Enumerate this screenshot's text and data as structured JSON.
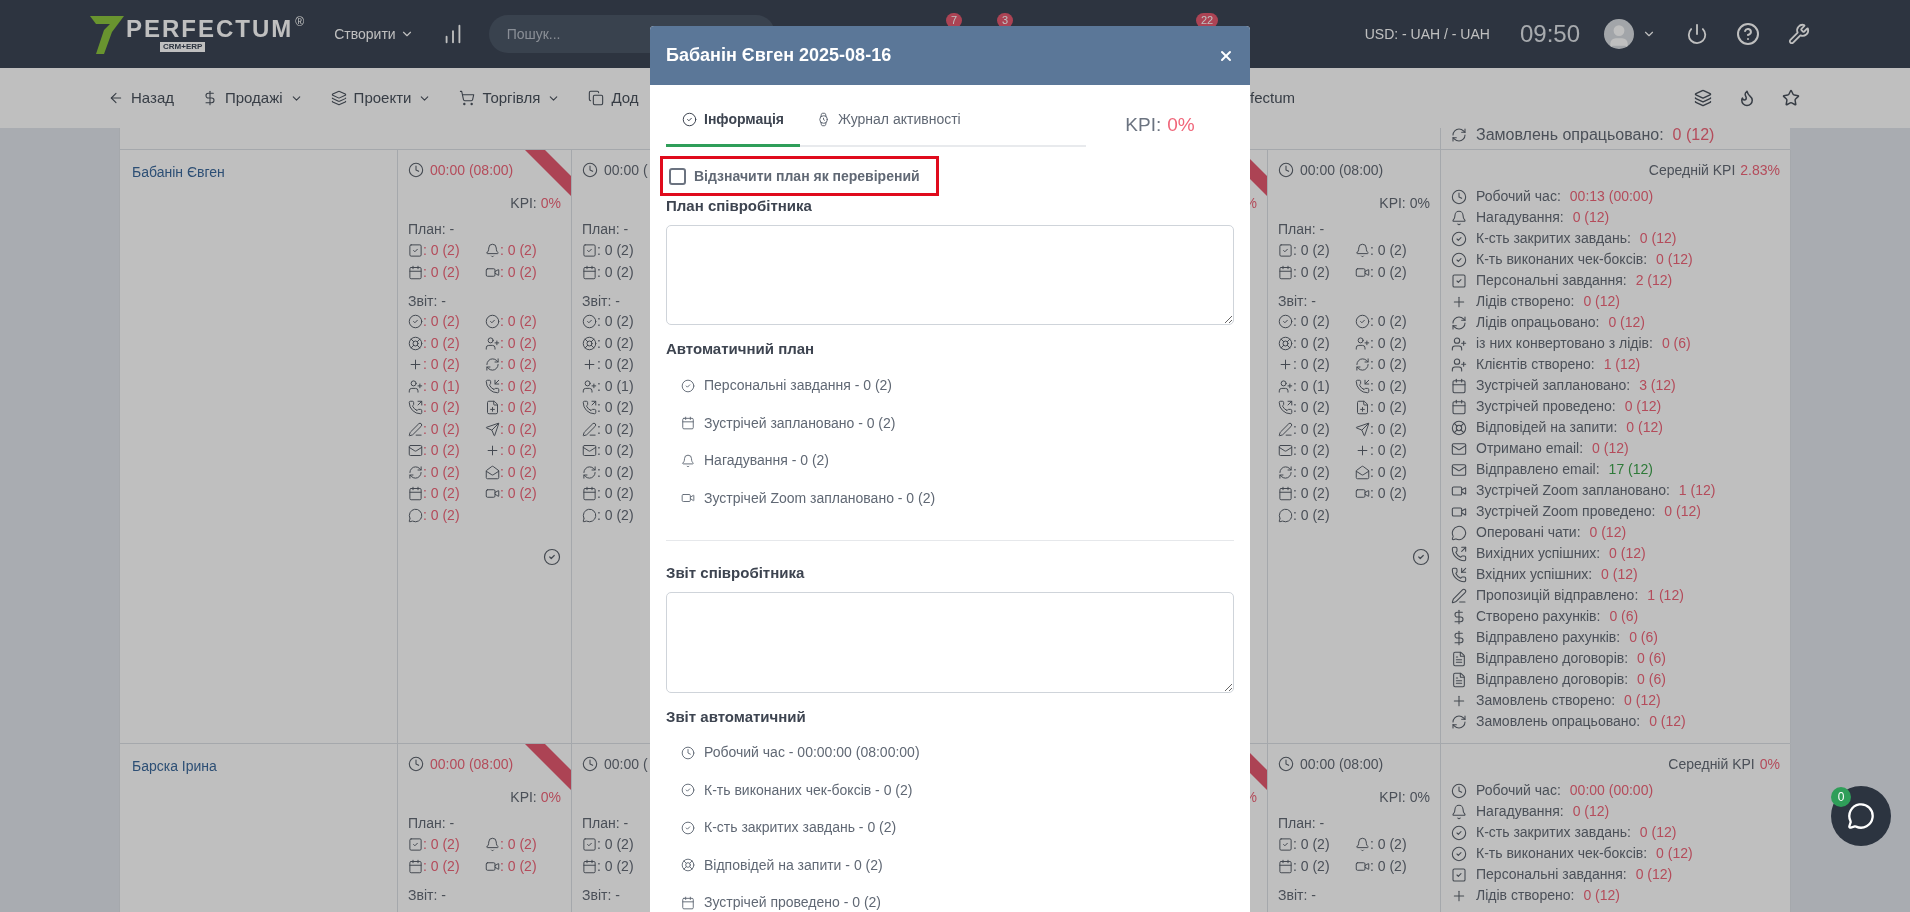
{
  "header": {
    "logo": {
      "name": "PERFECTUM",
      "mark": "®",
      "tag": "CRM+ERP"
    },
    "create_menu": "Створити",
    "search": {
      "placeholder": "Пошук..."
    },
    "badges": [
      "7",
      "3",
      "22"
    ],
    "currency": "USD: - UAH / - UAH",
    "clock": "09:50"
  },
  "subnav": {
    "items": [
      {
        "kind": "back",
        "label": "Назад",
        "dropdown": false
      },
      {
        "kind": "sales",
        "label": "Продажі",
        "dropdown": true
      },
      {
        "kind": "projects",
        "label": "Проекти",
        "dropdown": true
      },
      {
        "kind": "trade",
        "label": "Торгівля",
        "dropdown": true
      },
      {
        "kind": "extra",
        "label": "Дод",
        "dropdown": false
      }
    ],
    "tail": "fectum"
  },
  "table": {
    "previous_row": {
      "kind": "orders_processed",
      "label": "Замовлень опрацьовано:",
      "value": "0 (12)",
      "met": false
    },
    "rows": [
      {
        "name": "Бабанін Євген",
        "cells": [
          {
            "kind": "day",
            "flagged": true,
            "time": "00:00 (08:00)",
            "kpi_label": "KPI:",
            "kpi": "0%",
            "plan_label": "План: -",
            "plan": [
              {
                "kind": "personal_tasks",
                "value": ": 0 (2)"
              },
              {
                "kind": "reminders",
                "value": ": 0 (2)"
              },
              {
                "kind": "meetings_planned",
                "value": ": 0 (2)"
              },
              {
                "kind": "zoom_planned",
                "value": ": 0 (2)"
              }
            ],
            "report_label": "Звіт: -",
            "report": [
              {
                "kind": "closed_tasks",
                "value": ": 0 (2)"
              },
              {
                "kind": "checkboxes",
                "value": ": 0 (2)"
              },
              {
                "kind": "requests",
                "value": ": 0 (2)"
              },
              {
                "kind": "converted",
                "value": ": 0 (2)"
              },
              {
                "kind": "leads_created",
                "value": ": 0 (2)"
              },
              {
                "kind": "leads_processed",
                "value": ": 0 (2)"
              },
              {
                "kind": "clients",
                "value": ": 0 (1)"
              },
              {
                "kind": "calls_in",
                "value": ": 0 (2)"
              },
              {
                "kind": "calls_out",
                "value": ": 0 (2)"
              },
              {
                "kind": "contracts_created",
                "value": ": 0 (2)"
              },
              {
                "kind": "proposals",
                "value": ": 0 (2)"
              },
              {
                "kind": "offers_sent",
                "value": ": 0 (2)"
              },
              {
                "kind": "email_out",
                "value": ": 0 (2)"
              },
              {
                "kind": "orders_created",
                "value": ": 0 (2)"
              },
              {
                "kind": "orders_processed",
                "value": ": 0 (2)"
              },
              {
                "kind": "email_read",
                "value": ": 0 (2)"
              },
              {
                "kind": "meetings_held",
                "value": ": 0 (2)"
              },
              {
                "kind": "zoom_held",
                "value": ": 0 (2)"
              },
              {
                "kind": "chats",
                "value": ": 0 (2)"
              }
            ]
          },
          {
            "kind": "day_cut",
            "flagged": false,
            "time": "00:00 (",
            "plan_label": "План: -",
            "plan": [
              {
                "kind": "personal_tasks",
                "value": ": 0 (2)"
              },
              {
                "kind": "meetings_planned",
                "value": ": 0 (2)"
              }
            ],
            "report_label": "Звіт: -",
            "report": [
              {
                "kind": "closed_tasks",
                "value": ": 0 (2)"
              },
              {
                "kind": "requests",
                "value": ": 0 (2)"
              },
              {
                "kind": "leads_created",
                "value": ": 0 (2)"
              },
              {
                "kind": "clients",
                "value": ": 0 (1)"
              },
              {
                "kind": "calls_out",
                "value": ": 0 (2)"
              },
              {
                "kind": "proposals",
                "value": ": 0 (2)"
              },
              {
                "kind": "email_out",
                "value": ": 0 (2)"
              },
              {
                "kind": "orders_processed",
                "value": ": 0 (2)"
              },
              {
                "kind": "meetings_held",
                "value": ": 0 (2)"
              },
              {
                "kind": "chats",
                "value": ": 0 (2)"
              }
            ]
          },
          {
            "kind": "empty"
          },
          {
            "kind": "empty"
          },
          {
            "kind": "edge",
            "flagged": true,
            "kpi": "%"
          },
          {
            "kind": "day",
            "flagged": false,
            "time": "00:00 (08:00)",
            "kpi_label": "KPI:",
            "kpi": "0%",
            "plan_label": "План: -",
            "plan": [
              {
                "kind": "personal_tasks",
                "value": ": 0 (2)"
              },
              {
                "kind": "reminders",
                "value": ": 0 (2)"
              },
              {
                "kind": "meetings_planned",
                "value": ": 0 (2)"
              },
              {
                "kind": "zoom_planned",
                "value": ": 0 (2)"
              }
            ],
            "report_label": "Звіт: -",
            "report": [
              {
                "kind": "closed_tasks",
                "value": ": 0 (2)"
              },
              {
                "kind": "checkboxes",
                "value": ": 0 (2)"
              },
              {
                "kind": "requests",
                "value": ": 0 (2)"
              },
              {
                "kind": "converted",
                "value": ": 0 (2)"
              },
              {
                "kind": "leads_created",
                "value": ": 0 (2)"
              },
              {
                "kind": "leads_processed",
                "value": ": 0 (2)"
              },
              {
                "kind": "clients",
                "value": ": 0 (1)"
              },
              {
                "kind": "calls_in",
                "value": ": 0 (2)"
              },
              {
                "kind": "calls_out",
                "value": ": 0 (2)"
              },
              {
                "kind": "contracts_created",
                "value": ": 0 (2)"
              },
              {
                "kind": "proposals",
                "value": ": 0 (2)"
              },
              {
                "kind": "offers_sent",
                "value": ": 0 (2)"
              },
              {
                "kind": "email_out",
                "value": ": 0 (2)"
              },
              {
                "kind": "orders_created",
                "value": ": 0 (2)"
              },
              {
                "kind": "orders_processed",
                "value": ": 0 (2)"
              },
              {
                "kind": "email_read",
                "value": ": 0 (2)"
              },
              {
                "kind": "meetings_held",
                "value": ": 0 (2)"
              },
              {
                "kind": "zoom_held",
                "value": ": 0 (2)"
              },
              {
                "kind": "chats",
                "value": ": 0 (2)"
              }
            ]
          }
        ],
        "summary": {
          "kpi_label": "Середній KPI",
          "kpi": "2.83%",
          "items": [
            {
              "kind": "time",
              "label": "Робочий час:",
              "value": "00:13 (00:00)",
              "met": false
            },
            {
              "kind": "reminders",
              "label": "Нагадування:",
              "value": "0 (12)",
              "met": false
            },
            {
              "kind": "closed_tasks",
              "label": "К-сть закритих завдань:",
              "value": "0 (12)",
              "met": false
            },
            {
              "kind": "checkboxes",
              "label": "К-ть виконаних чек-боксів:",
              "value": "0 (12)",
              "met": false
            },
            {
              "kind": "personal_tasks",
              "label": "Персональні завдання:",
              "value": "2 (12)",
              "met": false
            },
            {
              "kind": "leads_created",
              "label": "Лідів створено:",
              "value": "0 (12)",
              "met": false
            },
            {
              "kind": "leads_processed",
              "label": "Лідів опрацьовано:",
              "value": "0 (12)",
              "met": false
            },
            {
              "kind": "converted",
              "label": "із них конвертовано з лідів:",
              "value": "0 (6)",
              "met": false
            },
            {
              "kind": "clients",
              "label": "Клієнтів створено:",
              "value": "1 (12)",
              "met": false
            },
            {
              "kind": "meetings_planned",
              "label": "Зустрічей заплановано:",
              "value": "3 (12)",
              "met": false
            },
            {
              "kind": "meetings_held",
              "label": "Зустрічей проведено:",
              "value": "0 (12)",
              "met": false
            },
            {
              "kind": "requests",
              "label": "Відповідей на запити:",
              "value": "0 (12)",
              "met": false
            },
            {
              "kind": "email_in",
              "label": "Отримано email:",
              "value": "0 (12)",
              "met": false
            },
            {
              "kind": "email_out",
              "label": "Відправлено email:",
              "value": "17 (12)",
              "met": true
            },
            {
              "kind": "zoom_planned",
              "label": "Зустрічей Zoom заплановано:",
              "value": "1 (12)",
              "met": false
            },
            {
              "kind": "zoom_held",
              "label": "Зустрічей Zoom проведено:",
              "value": "0 (12)",
              "met": false
            },
            {
              "kind": "chats",
              "label": "Оперовані чати:",
              "value": "0 (12)",
              "met": false
            },
            {
              "kind": "calls_out",
              "label": "Вихідних успішних:",
              "value": "0 (12)",
              "met": false
            },
            {
              "kind": "calls_in",
              "label": "Вхідних успішних:",
              "value": "0 (12)",
              "met": false
            },
            {
              "kind": "proposals",
              "label": "Пропозицій відправлено:",
              "value": "1 (12)",
              "met": false
            },
            {
              "kind": "invoices_created",
              "label": "Створено рахунків:",
              "value": "0 (6)",
              "met": false
            },
            {
              "kind": "invoices_sent",
              "label": "Відправлено рахунків:",
              "value": "0 (6)",
              "met": false
            },
            {
              "kind": "contracts_sent",
              "label": "Відправлено договорів:",
              "value": "0 (6)",
              "met": false
            },
            {
              "kind": "contracts_sent",
              "label": "Відправлено договорів:",
              "value": "0 (6)",
              "met": false
            },
            {
              "kind": "orders_created",
              "label": "Замовлень створено:",
              "value": "0 (12)",
              "met": false
            },
            {
              "kind": "orders_processed",
              "label": "Замовлень опрацьовано:",
              "value": "0 (12)",
              "met": false
            }
          ]
        }
      },
      {
        "name": "Барска Ірина",
        "cells": [
          {
            "kind": "day",
            "flagged": true,
            "time": "00:00 (08:00)",
            "kpi_label": "KPI:",
            "kpi": "0%",
            "plan_label": "План: -",
            "plan": [
              {
                "kind": "personal_tasks",
                "value": ": 0 (2)"
              },
              {
                "kind": "reminders",
                "value": ": 0 (2)"
              },
              {
                "kind": "meetings_planned",
                "value": ": 0 (2)"
              },
              {
                "kind": "zoom_planned",
                "value": ": 0 (2)"
              }
            ],
            "report_label": "Звіт: -"
          },
          {
            "kind": "day_cut",
            "flagged": false,
            "time": "00:00 (",
            "plan_label": "План: -",
            "plan": [
              {
                "kind": "personal_tasks",
                "value": ": 0 (2)"
              },
              {
                "kind": "meetings_planned",
                "value": ": 0 (2)"
              }
            ],
            "report_label": "Звіт: -"
          },
          {
            "kind": "empty"
          },
          {
            "kind": "empty"
          },
          {
            "kind": "edge",
            "flagged": true,
            "kpi": "%"
          },
          {
            "kind": "day",
            "flagged": false,
            "time": "00:00 (08:00)",
            "kpi_label": "KPI:",
            "kpi": "0%",
            "plan_label": "План: -",
            "plan": [
              {
                "kind": "personal_tasks",
                "value": ": 0 (2)"
              },
              {
                "kind": "reminders",
                "value": ": 0 (2)"
              },
              {
                "kind": "meetings_planned",
                "value": ": 0 (2)"
              },
              {
                "kind": "zoom_planned",
                "value": ": 0 (2)"
              }
            ],
            "report_label": "Звіт: -"
          }
        ],
        "summary": {
          "kpi_label": "Середній KPI",
          "kpi": "0%",
          "items": [
            {
              "kind": "time",
              "label": "Робочий час:",
              "value": "00:00 (00:00)",
              "met": false
            },
            {
              "kind": "reminders",
              "label": "Нагадування:",
              "value": "0 (12)",
              "met": false
            },
            {
              "kind": "closed_tasks",
              "label": "К-сть закритих завдань:",
              "value": "0 (12)",
              "met": false
            },
            {
              "kind": "checkboxes",
              "label": "К-ть виконаних чек-боксів:",
              "value": "0 (12)",
              "met": false
            },
            {
              "kind": "personal_tasks",
              "label": "Персональні завдання:",
              "value": "0 (12)",
              "met": false
            },
            {
              "kind": "leads_created",
              "label": "Лідів створено:",
              "value": "0 (12)",
              "met": false
            }
          ]
        }
      }
    ]
  },
  "modal": {
    "title": "Бабанін Євген 2025-08-16",
    "tabs": [
      {
        "kind": "info",
        "label": "Інформація",
        "selected": true
      },
      {
        "kind": "log",
        "label": "Журнал активності",
        "selected": false
      }
    ],
    "kpi_label": "KPI:",
    "kpi": "0%",
    "verify": {
      "label": "Відзначити план як перевірений",
      "checked": false
    },
    "plan_heading": "План співробітника",
    "auto_plan_heading": "Автоматичний план",
    "auto_plan": [
      {
        "kind": "checkboxes",
        "text": "Персональні завдання - 0 (2)"
      },
      {
        "kind": "meetings_planned",
        "text": "Зустрічей заплановано - 0 (2)"
      },
      {
        "kind": "reminders",
        "text": "Нагадування - 0 (2)"
      },
      {
        "kind": "zoom_planned",
        "text": "Зустрічей Zoom заплановано - 0 (2)"
      }
    ],
    "report_heading": "Звіт співробітника",
    "auto_report_heading": "Звіт автоматичний",
    "auto_report": [
      {
        "kind": "time",
        "text": "Робочий час - 00:00:00 (08:00:00)"
      },
      {
        "kind": "checkboxes",
        "text": "К-ть виконаних чек-боксів - 0 (2)"
      },
      {
        "kind": "closed_tasks",
        "text": "К-сть закритих завдань - 0 (2)"
      },
      {
        "kind": "requests",
        "text": "Відповідей на запити - 0 (2)"
      },
      {
        "kind": "meetings_held",
        "text": "Зустрічей проведено - 0 (2)"
      }
    ]
  },
  "chat": {
    "badge": "0"
  }
}
